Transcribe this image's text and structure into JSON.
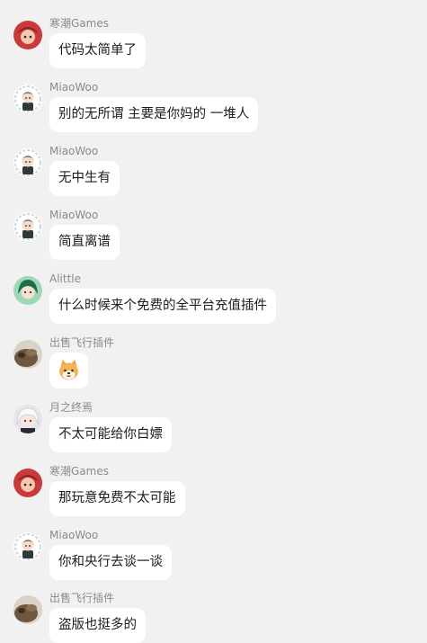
{
  "messages": [
    {
      "sender": "寒潮Games",
      "text": "代码太简单了",
      "avatar_icon": "red-hair-anime-avatar-icon"
    },
    {
      "sender": "MiaoWoo",
      "text": "别的无所谓 主要是你妈的 一堆人",
      "avatar_icon": "chibi-character-avatar-icon"
    },
    {
      "sender": "MiaoWoo",
      "text": "无中生有",
      "avatar_icon": "chibi-character-avatar-icon"
    },
    {
      "sender": "MiaoWoo",
      "text": "简直离谱",
      "avatar_icon": "chibi-character-avatar-icon"
    },
    {
      "sender": "Alittle",
      "text": "什么时候来个免费的全平台充值插件",
      "avatar_icon": "green-anime-avatar-icon"
    },
    {
      "sender": "出售飞行插件",
      "text": "",
      "avatar_icon": "brown-animal-avatar-icon",
      "emoji": "shiba-dog-emoji-icon"
    },
    {
      "sender": "月之终焉",
      "text": "不太可能给你白嫖",
      "avatar_icon": "white-hair-anime-avatar-icon"
    },
    {
      "sender": "寒潮Games",
      "text": "那玩意免费不太可能",
      "avatar_icon": "red-hair-anime-avatar-icon"
    },
    {
      "sender": "MiaoWoo",
      "text": "你和央行去谈一谈",
      "avatar_icon": "chibi-character-avatar-icon"
    },
    {
      "sender": "出售飞行插件",
      "text": "盗版也挺多的",
      "avatar_icon": "brown-animal-avatar-icon"
    }
  ],
  "colors": {
    "background": "#f1f1f1",
    "bubble": "#ffffff",
    "sender_text": "#8a8a8a",
    "message_text": "#1c1c1c"
  }
}
